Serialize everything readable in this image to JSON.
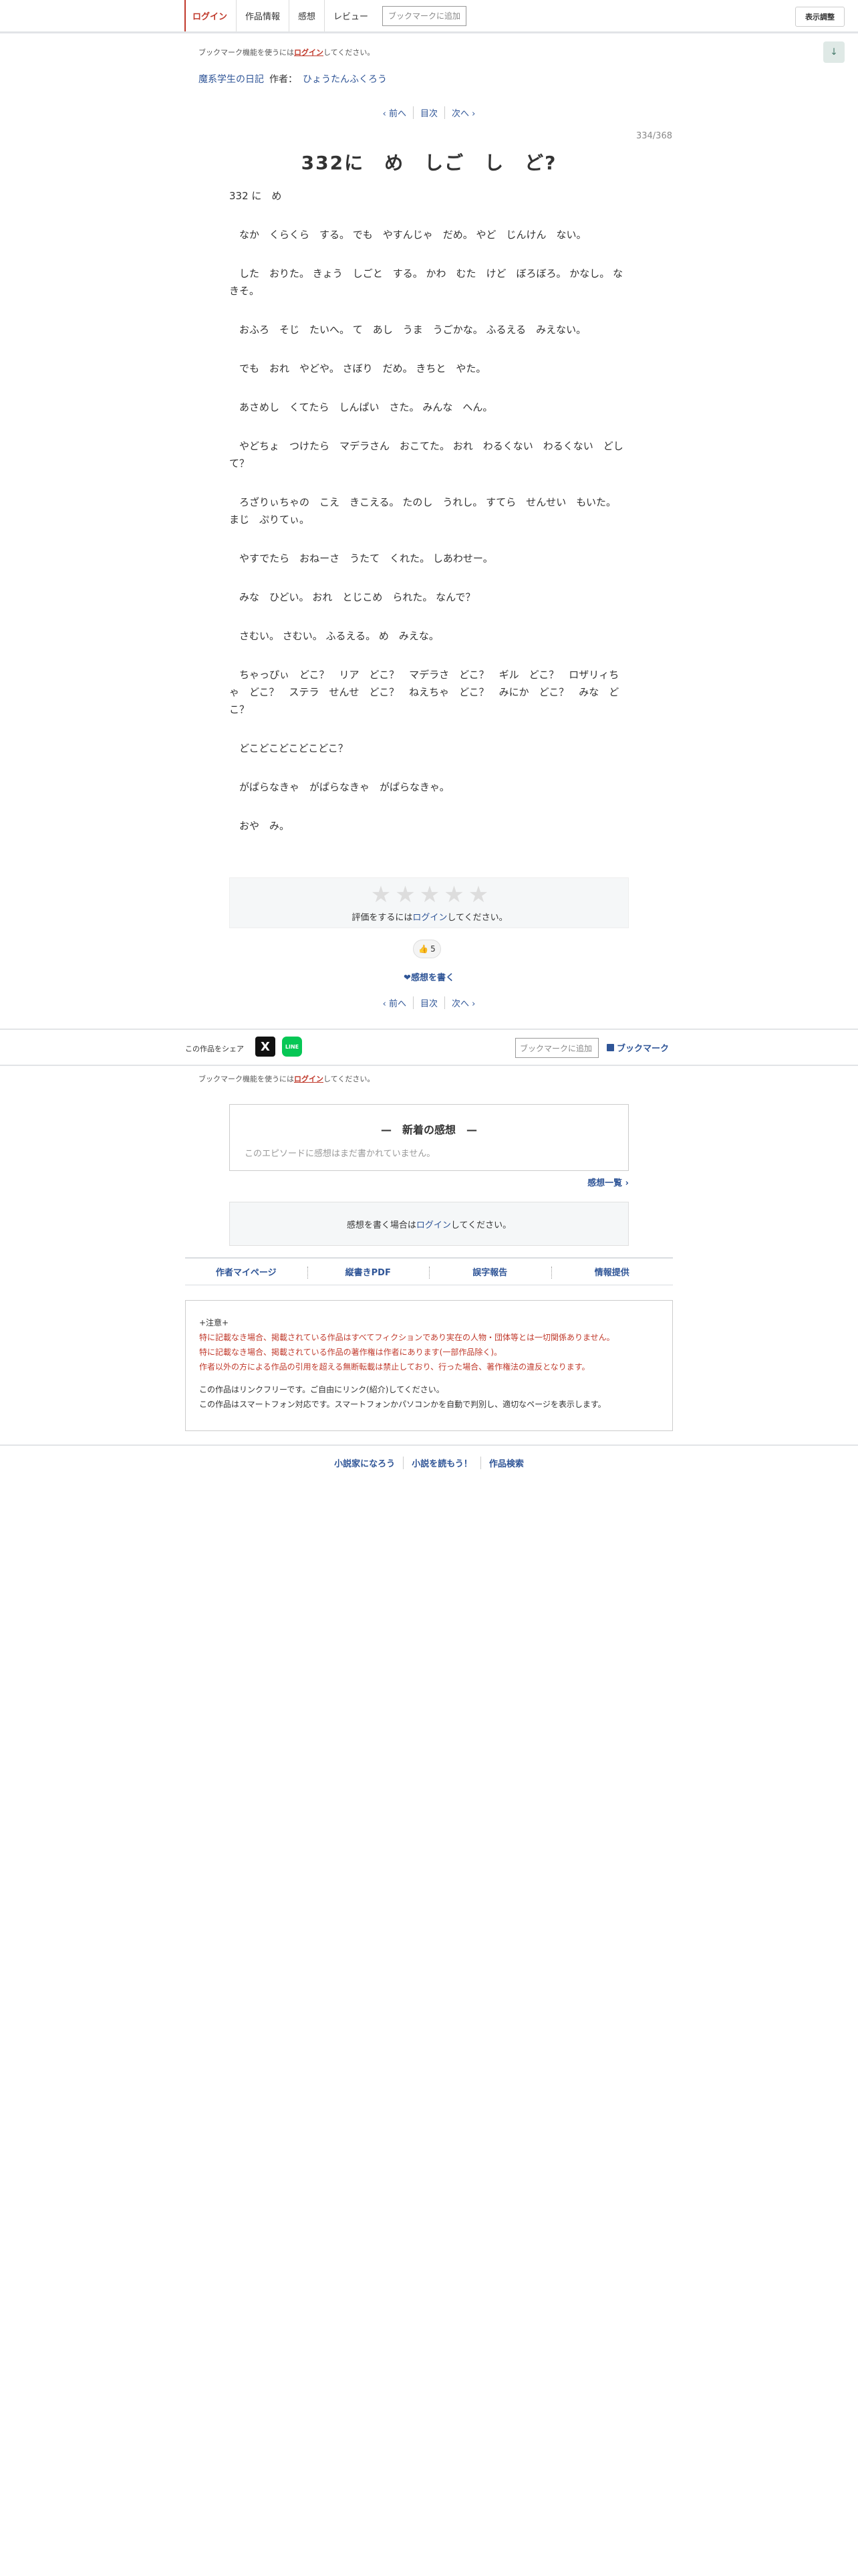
{
  "topnav": {
    "login": "ログイン",
    "work_info": "作品情報",
    "impressions": "感想",
    "review": "レビュー",
    "bookmark_add": "ブックマークに追加",
    "display_settings": "表示調整",
    "scroll_icon": "↓"
  },
  "bookmark_note": {
    "prefix": "ブックマーク機能を使うには",
    "link": "ログイン",
    "suffix": "してください。"
  },
  "series": {
    "title": "魔系学生の日記",
    "author_label": "作者：",
    "author": "ひょうたんふくろう"
  },
  "pager": {
    "prev": "‹ 前へ",
    "index": "目次",
    "next": "次へ ›"
  },
  "episode": {
    "count": "334/368",
    "title": "332に　め　しご　し　ど?"
  },
  "body": [
    "332 に　め",
    "",
    "　なか　くらくら　する。 でも　やすんじゃ　だめ。 やど　じんけん　ない。",
    "",
    "　した　おりた。 きょう　しごと　する。 かわ　むた　けど　ぼろぼろ。 かなし。 なきそ。",
    "",
    "　おふろ　そじ　たいへ。 て　あし　うま　うごかな。 ふるえる　みえない。",
    "",
    "　でも　おれ　やどや。 さぼり　だめ。 きちと　やた。",
    "",
    "　あさめし　くてたら　しんぱい　さた。 みんな　へん。",
    "",
    "　やどちょ　つけたら　マデラさん　おこてた。 おれ　わるくない　わるくない　どして？",
    "",
    "　ろざりぃちゃの　こえ　きこえる。 たのし　うれし。 すてら　せんせい　もいた。 まじ　ぷりてぃ。",
    "",
    "　やすでたら　おねーさ　うたて　くれた。 しあわせー。",
    "",
    "　みな　ひどい。 おれ　とじこめ　られた。 なんで？",
    "",
    "　さむい。 さむい。 ふるえる。 め　みえな。",
    "",
    "　ちゃっぴぃ　どこ？　リア　どこ？　マデラさ　どこ？　ギル　どこ？　ロザリィちゃ　どこ？　ステラ　せんせ　どこ？　ねえちゃ　どこ？　みにか　どこ？　みな　どこ？",
    "",
    "　どこどこどこどこどこ？",
    "",
    "　がぱらなきゃ　がぱらなきゃ　がぱらなきゃ。",
    "",
    "　おや　み。"
  ],
  "rating": {
    "stars": 5,
    "note_prefix": "評価をするには",
    "note_link": "ログイン",
    "note_suffix": "してください。"
  },
  "like": {
    "icon": "thumbs-up-icon",
    "count": "5"
  },
  "write_impression": "❤感想を書く",
  "share": {
    "label": "この作品をシェア",
    "x_glyph": "X",
    "line_glyph": "LINE",
    "bookmark_placeholder": "ブックマークに追加",
    "bookmark_button": "ブックマーク"
  },
  "impressions": {
    "title": "—　新着の感想　—",
    "empty": "このエピソードに感想はまだ書かれていません。",
    "list_link": "感想一覧 ›",
    "login_prefix": "感想を書く場合は",
    "login_link": "ログイン",
    "login_suffix": "してください。"
  },
  "bottom_links": [
    "作者マイページ",
    "縦書きPDF",
    "誤字報告",
    "情報提供"
  ],
  "notice": {
    "heading": "+注意+",
    "red_lines": [
      "特に記載なき場合、掲載されている作品はすべてフィクションであり実在の人物・団体等とは一切関係ありません。",
      "特に記載なき場合、掲載されている作品の著作権は作者にあります(一部作品除く)。",
      "作者以外の方による作品の引用を超える無断転載は禁止しており、行った場合、著作権法の違反となります。"
    ],
    "normal_lines": [
      "この作品はリンクフリーです。ご自由にリンク(紹介)してください。",
      "この作品はスマートフォン対応です。スマートフォンかパソコンかを自動で判別し、適切なページを表示します。"
    ]
  },
  "footer": [
    "小説家になろう",
    "小説を読もう！",
    "作品検索"
  ],
  "colors": {
    "accent_red": "#c0392b",
    "link_blue": "#2f5597",
    "line_green": "#06c755"
  }
}
